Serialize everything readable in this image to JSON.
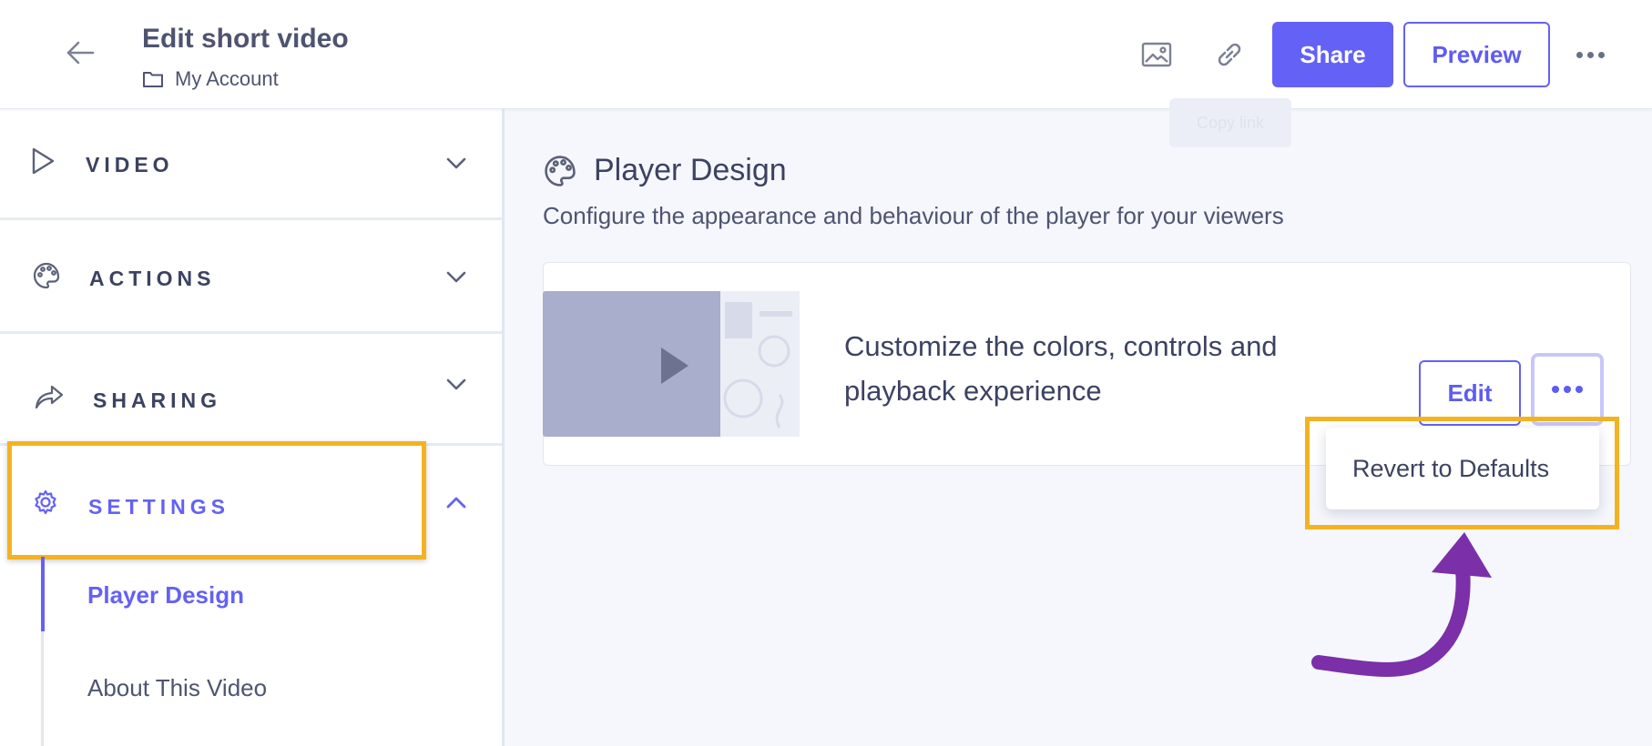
{
  "header": {
    "title": "Edit short video",
    "account": "My Account",
    "tooltip": "Copy link",
    "share_label": "Share",
    "preview_label": "Preview"
  },
  "sidebar": {
    "sections": [
      {
        "label": "VIDEO",
        "icon": "play-icon",
        "expanded": false
      },
      {
        "label": "ACTIONS",
        "icon": "palette-icon",
        "expanded": false
      },
      {
        "label": "SHARING",
        "icon": "share-arrow-icon",
        "expanded": false
      },
      {
        "label": "SETTINGS",
        "icon": "gear-icon",
        "expanded": true
      }
    ],
    "sub_items": [
      {
        "label": "Player Design",
        "active": true
      },
      {
        "label": "About This Video",
        "active": false
      }
    ]
  },
  "main": {
    "title": "Player Design",
    "description": "Configure the appearance and behaviour of the player for your viewers",
    "card": {
      "text": "Customize the colors, controls and playback experience",
      "edit_label": "Edit"
    },
    "menu": {
      "items": [
        "Revert to Defaults"
      ]
    }
  },
  "colors": {
    "accent": "#6461f6",
    "highlight": "#f3b321",
    "arrow": "#7b2fa8",
    "text": "#3c4260"
  }
}
